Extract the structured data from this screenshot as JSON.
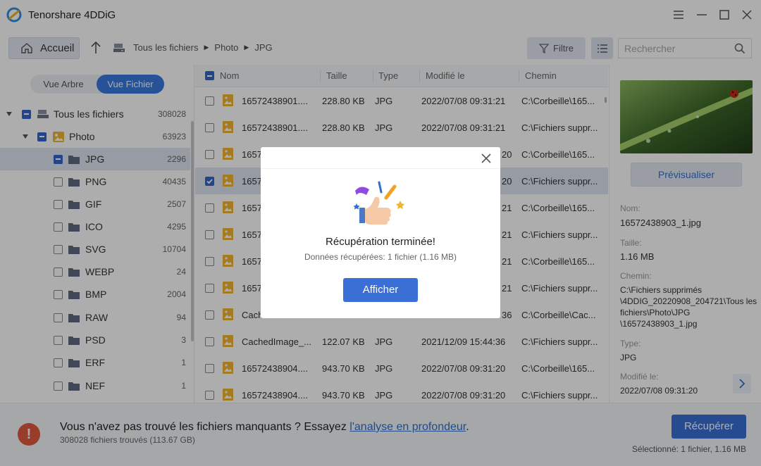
{
  "app": {
    "title": "Tenorshare 4DDiG"
  },
  "toolbar": {
    "home_label": "Accueil",
    "breadcrumb": [
      "Tous les fichiers",
      "Photo",
      "JPG"
    ],
    "filter_label": "Filtre",
    "search_placeholder": "Rechercher"
  },
  "left": {
    "view_tree": "Vue Arbre",
    "view_file": "Vue Fichier",
    "items": [
      {
        "label": "Tous les fichiers",
        "count": "308028"
      },
      {
        "label": "Photo",
        "count": "63923"
      },
      {
        "label": "JPG",
        "count": "2296"
      },
      {
        "label": "PNG",
        "count": "40435"
      },
      {
        "label": "GIF",
        "count": "2507"
      },
      {
        "label": "ICO",
        "count": "4295"
      },
      {
        "label": "SVG",
        "count": "10704"
      },
      {
        "label": "WEBP",
        "count": "24"
      },
      {
        "label": "BMP",
        "count": "2004"
      },
      {
        "label": "RAW",
        "count": "94"
      },
      {
        "label": "PSD",
        "count": "3"
      },
      {
        "label": "ERF",
        "count": "1"
      },
      {
        "label": "NEF",
        "count": "1"
      }
    ]
  },
  "list": {
    "headers": {
      "name": "Nom",
      "size": "Taille",
      "type": "Type",
      "modified": "Modifié le",
      "path": "Chemin"
    },
    "rows": [
      {
        "name": "16572438901....",
        "size": "228.80 KB",
        "type": "JPG",
        "modified": "2022/07/08 09:31:21",
        "path": "C:\\Corbeille\\165..."
      },
      {
        "name": "16572438901....",
        "size": "228.80 KB",
        "type": "JPG",
        "modified": "2022/07/08 09:31:21",
        "path": "C:\\Fichiers suppr..."
      },
      {
        "name": "1657",
        "size": "",
        "type": "",
        "modified": "20",
        "path": "C:\\Corbeille\\165..."
      },
      {
        "name": "1657",
        "size": "",
        "type": "",
        "modified": "20",
        "path": "C:\\Fichiers suppr..."
      },
      {
        "name": "1657",
        "size": "",
        "type": "",
        "modified": "21",
        "path": "C:\\Corbeille\\165..."
      },
      {
        "name": "1657",
        "size": "",
        "type": "",
        "modified": "21",
        "path": "C:\\Fichiers suppr..."
      },
      {
        "name": "1657",
        "size": "",
        "type": "",
        "modified": "21",
        "path": "C:\\Corbeille\\165..."
      },
      {
        "name": "1657",
        "size": "",
        "type": "",
        "modified": "21",
        "path": "C:\\Fichiers suppr..."
      },
      {
        "name": "Cach",
        "size": "",
        "type": "",
        "modified": "36",
        "path": "C:\\Corbeille\\Cac..."
      },
      {
        "name": "CachedImage_...",
        "size": "122.07 KB",
        "type": "JPG",
        "modified": "2021/12/09 15:44:36",
        "path": "C:\\Fichiers suppr..."
      },
      {
        "name": "16572438904....",
        "size": "943.70 KB",
        "type": "JPG",
        "modified": "2022/07/08 09:31:20",
        "path": "C:\\Corbeille\\165..."
      },
      {
        "name": "16572438904....",
        "size": "943.70 KB",
        "type": "JPG",
        "modified": "2022/07/08 09:31:20",
        "path": "C:\\Fichiers suppr..."
      }
    ]
  },
  "right": {
    "preview_label": "Prévisualiser",
    "name_label": "Nom:",
    "name_value": "16572438903_1.jpg",
    "size_label": "Taille:",
    "size_value": "1.16 MB",
    "path_label": "Chemin:",
    "path_value": "C:\\Fichiers supprimés \\4DDIG_20220908_204721\\Tous les fichiers\\Photo\\JPG \\16572438903_1.jpg",
    "type_label": "Type:",
    "type_value": "JPG",
    "modified_label": "Modifié le:",
    "modified_value": "2022/07/08 09:31:20"
  },
  "bottom": {
    "message": "Vous n'avez pas trouvé les fichiers manquants ? Essayez ",
    "link": "l'analyse en profondeur",
    "period": ".",
    "found": "308028 fichiers trouvés (113.67 GB)",
    "recover_label": "Récupérer",
    "selected": "Sélectionné: 1 fichier, 1.16 MB",
    "warn_glyph": "!"
  },
  "modal": {
    "title": "Récupération terminée!",
    "subtitle": "Données récupérées: 1 fichier (1.16 MB)",
    "button": "Afficher"
  },
  "colors": {
    "accent": "#3a6fd6",
    "selection": "#dde5f2",
    "warning": "#e05a3e"
  }
}
